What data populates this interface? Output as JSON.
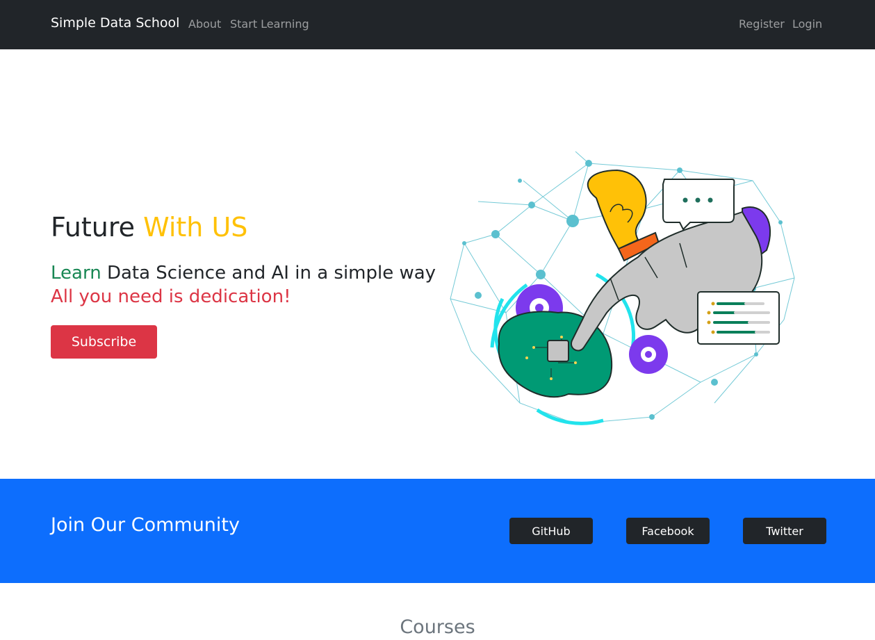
{
  "navbar": {
    "brand": "Simple Data School",
    "links": [
      "About",
      "Start Learning"
    ],
    "right_links": [
      "Register",
      "Login"
    ]
  },
  "hero": {
    "title_part1": "Future",
    "title_part2": "With US",
    "line1_accent": "Learn",
    "line1_rest": "Data Science and AI in a simple way",
    "line2": "All you need is dedication!",
    "subscribe_label": "Subscribe",
    "illustration": "robot-hand-brain-network-illustration"
  },
  "community": {
    "title": "Join Our Community",
    "buttons": [
      "GitHub",
      "Facebook",
      "Twitter"
    ]
  },
  "courses": {
    "title": "Courses"
  },
  "colors": {
    "navbar_bg": "#212529",
    "accent_yellow": "#ffc107",
    "accent_green": "#198754",
    "accent_red": "#dc3545",
    "community_bg": "#0d6efd",
    "social_button_bg": "#212529"
  }
}
